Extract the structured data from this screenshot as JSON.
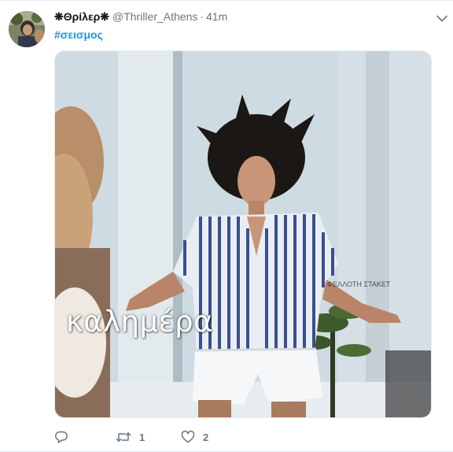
{
  "tweet": {
    "display_name": "❋Θρίλερ❋",
    "handle": "@Thriller_Athens",
    "separator": "·",
    "time": "41m",
    "hashtag": "#σεισμος",
    "media": {
      "caption": "καλημέρα",
      "watermark": "ΦΕΛΛΟΤΗ ΣΤΑΚΕΤ"
    },
    "actions": {
      "reply_icon": "reply-icon",
      "retweet_icon": "retweet-icon",
      "retweet_count": "1",
      "like_icon": "heart-icon",
      "like_count": "2"
    },
    "menu_icon": "chevron-down-icon"
  },
  "colors": {
    "link": "#1b95e0",
    "secondary_text": "#657786",
    "primary_text": "#14171a",
    "border": "#e6ecf0"
  }
}
